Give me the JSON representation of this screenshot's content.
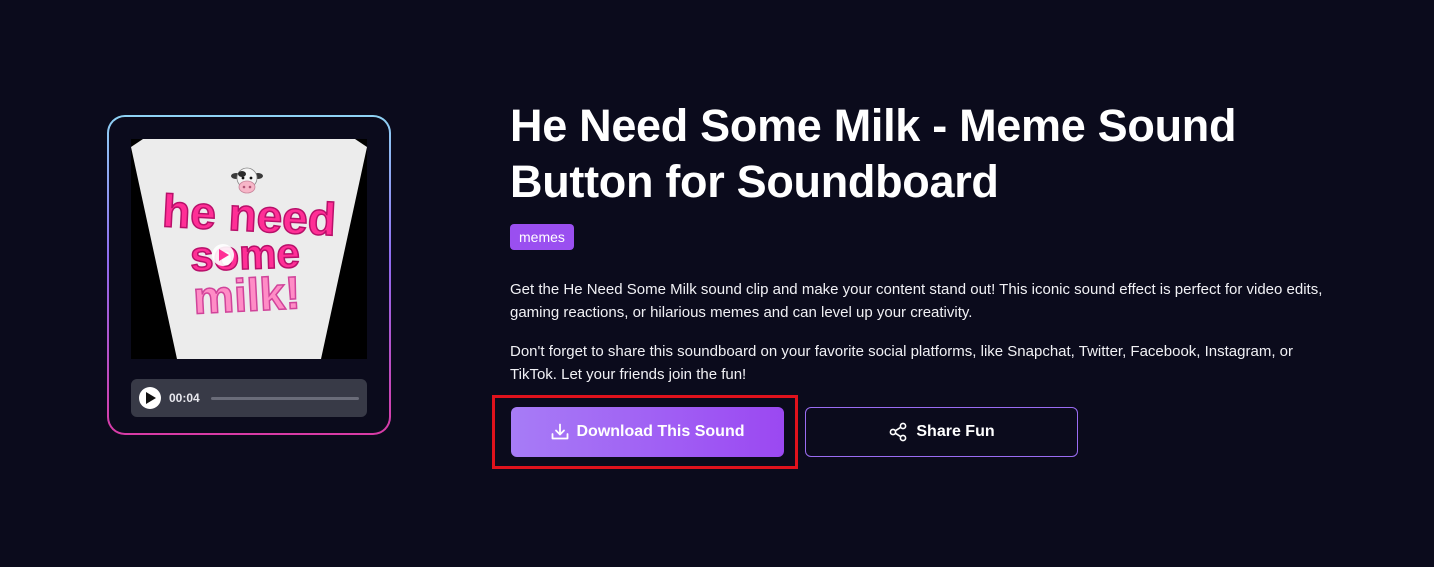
{
  "sound": {
    "title": "He Need Some Milk - Meme Sound Button for Soundboard",
    "tag": "memes",
    "description": [
      "Get the He Need Some Milk sound clip and make your content stand out! This iconic sound effect is perfect for video edits, gaming reactions, or hilarious memes and can level up your creativity.",
      "Don't forget to share this soundboard on your favorite social platforms, like Snapchat, Twitter, Facebook, Instagram, or TikTok. Let your friends join the fun!"
    ]
  },
  "thumbnail": {
    "text_lines": [
      "he need",
      "some",
      "milk!"
    ],
    "icon": "cow-face-icon"
  },
  "player": {
    "time": "00:04",
    "progress": 0,
    "play_icon": "play-icon"
  },
  "actions": {
    "download_label": "Download This Sound",
    "download_icon": "download-icon",
    "share_label": "Share Fun",
    "share_icon": "share-icon"
  },
  "colors": {
    "background": "#0b0b1c",
    "accent": "#9b48f2",
    "tag": "#9a4ff0",
    "highlight": "#e0121c",
    "thumbnail_text": "#ff2f96"
  }
}
